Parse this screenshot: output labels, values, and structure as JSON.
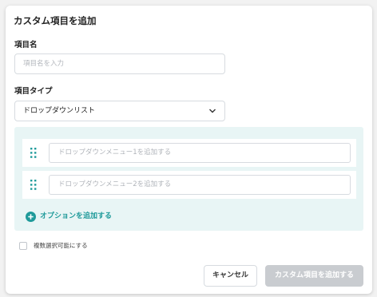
{
  "dialog": {
    "title": "カスタム項目を追加",
    "name_label": "項目名",
    "name_placeholder": "項目名を入力",
    "type_label": "項目タイプ",
    "type_value": "ドロップダウンリスト",
    "options": [
      {
        "placeholder": "ドロップダウンメニュー1を追加する"
      },
      {
        "placeholder": "ドロップダウンメニュー2を追加する"
      }
    ],
    "add_option_label": "オプションを追加する",
    "multi_select_label": "複数選択可能にする",
    "multi_select_checked": false,
    "cancel_label": "キャンセル",
    "submit_label": "カスタム項目を追加する",
    "submit_enabled": false
  },
  "colors": {
    "accent": "#1f9a9a",
    "panel_bg": "#e8f5f5",
    "disabled_button": "#c9ccd0"
  },
  "icons": {
    "drag_handle": "drag-handle-icon",
    "add": "plus-circle-icon",
    "dropdown": "chevron-down-icon"
  }
}
